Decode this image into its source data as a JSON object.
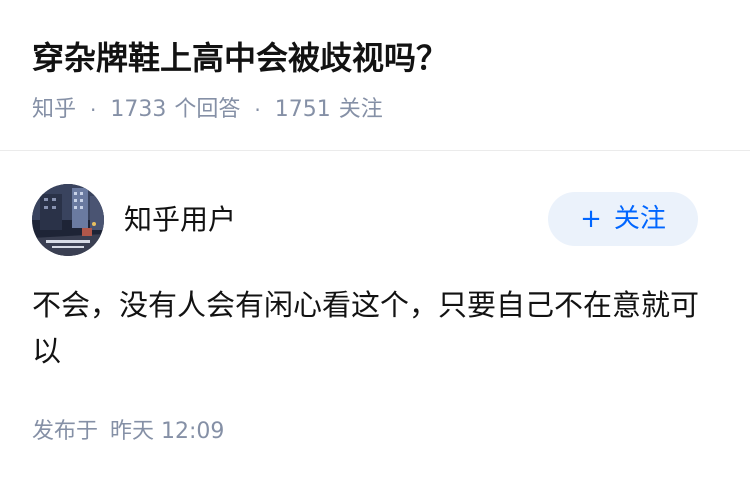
{
  "question": {
    "title": "穿杂牌鞋上高中会被歧视吗？",
    "meta": {
      "source": "知乎",
      "answer_count": "1733",
      "answer_label": "个回答",
      "follower_count": "1751",
      "follower_label": "关注",
      "separator": "·"
    }
  },
  "answer": {
    "author": {
      "name": "知乎用户",
      "avatar_icon": "avatar-city-street-photo"
    },
    "follow_button": {
      "icon": "+",
      "label": "关注"
    },
    "content": "不会，没有人会有闲心看这个，只要自己不在意就可以",
    "time": {
      "prefix": "发布于",
      "value": "昨天 12:09"
    }
  },
  "colors": {
    "title": "#121212",
    "meta": "#8590a6",
    "follow_bg": "#ebf2fb",
    "follow_text": "#0066ff",
    "divider": "#ebebeb"
  }
}
